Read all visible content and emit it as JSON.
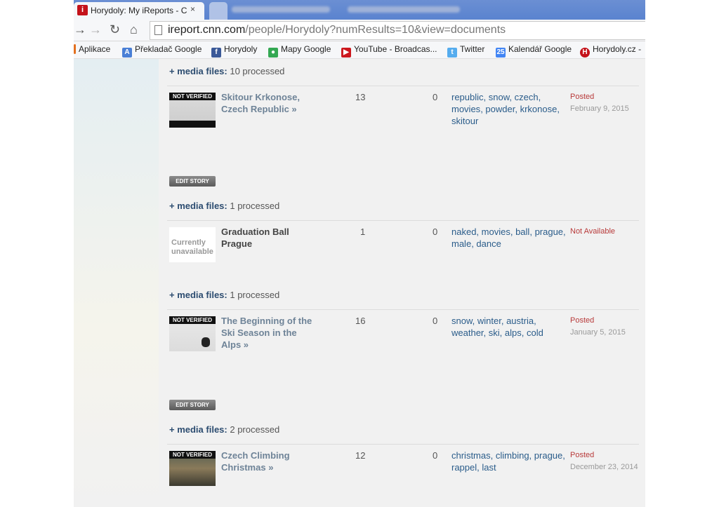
{
  "browser": {
    "active_tab_title": "Horydoly: My iReports - C",
    "tab_close": "×",
    "url_host": "ireport.cnn.com",
    "url_path": "/people/Horydoly?numResults=10&view=documents",
    "bookmarks": [
      {
        "label": "Aplikace",
        "icon": "apps-icon",
        "color": "#e36f1e"
      },
      {
        "label": "Překladač Google",
        "icon": "translate-icon",
        "color": "#4a7fd6"
      },
      {
        "label": "Horydoly",
        "icon": "facebook-icon",
        "color": "#3b5998"
      },
      {
        "label": "Mapy Google",
        "icon": "maps-icon",
        "color": "#34a853"
      },
      {
        "label": "YouTube - Broadcas...",
        "icon": "youtube-icon",
        "color": "#cc181e"
      },
      {
        "label": "Twitter",
        "icon": "twitter-icon",
        "color": "#55acee"
      },
      {
        "label": "Kalendář Google",
        "icon": "calendar-icon",
        "color": "#4285f4",
        "glyph": "25"
      },
      {
        "label": "Horydoly.cz -",
        "icon": "horydoly-icon",
        "color": "#c4121a"
      }
    ]
  },
  "content": {
    "media_label": "+ media files:",
    "edit_label": "EDIT STORY",
    "badge_label": "NOT VERIFIED",
    "media_top": "10 processed",
    "stories": [
      {
        "title": "Skitour Krkonose, Czech Republic »",
        "views": "13",
        "comments": "0",
        "tags": [
          "republic",
          "snow",
          "czech",
          "movies",
          "powder",
          "krkonose",
          "skitour"
        ],
        "status": "Posted",
        "date": "February 9, 2015",
        "media_after": "1 processed"
      },
      {
        "title": "Graduation Ball Prague",
        "thumb_text": "Currently unavailable",
        "views": "1",
        "comments": "0",
        "tags": [
          "naked",
          "movies",
          "ball",
          "prague",
          "male",
          "dance"
        ],
        "status": "Not Available",
        "date": "",
        "media_after": "1 processed"
      },
      {
        "title": "The Beginning of the Ski Season in the Alps »",
        "views": "16",
        "comments": "0",
        "tags": [
          "snow",
          "winter",
          "austria",
          "weather",
          "ski",
          "alps",
          "cold"
        ],
        "status": "Posted",
        "date": "January 5, 2015",
        "media_after": "2 processed"
      },
      {
        "title": "Czech Climbing Christmas »",
        "views": "12",
        "comments": "0",
        "tags": [
          "christmas",
          "climbing",
          "prague",
          "rappel",
          "last"
        ],
        "status": "Posted",
        "date": "December 23, 2014"
      }
    ]
  }
}
